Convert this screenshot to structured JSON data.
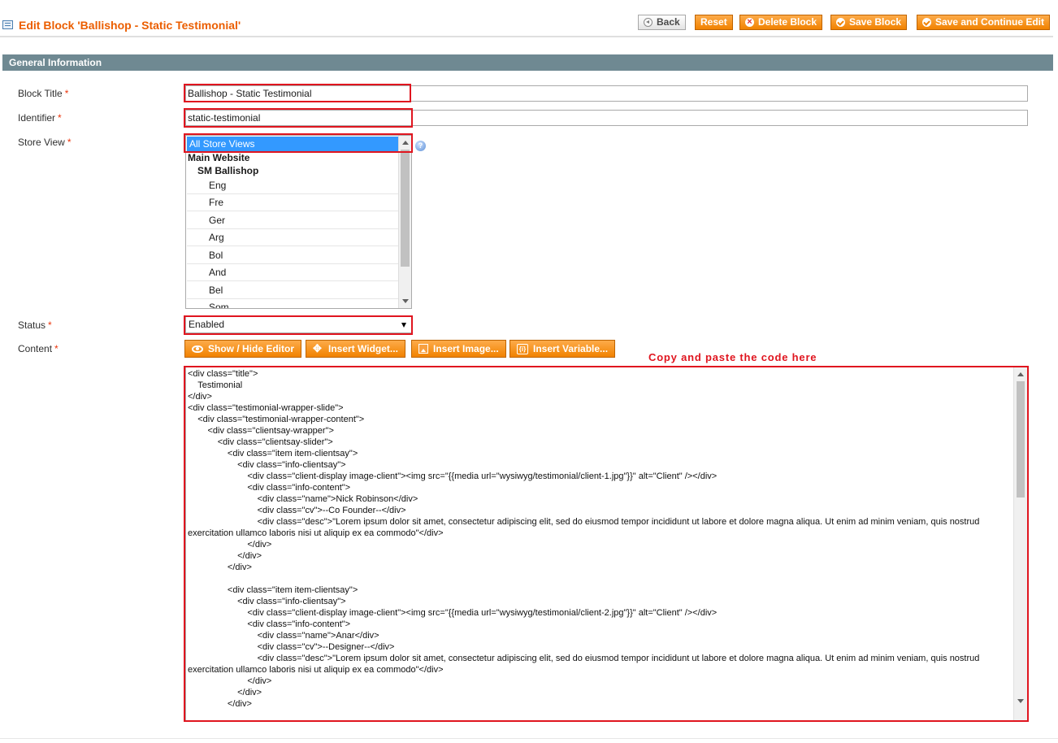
{
  "header": {
    "title": "Edit Block 'Ballishop - Static Testimonial'",
    "icon": "grid-icon",
    "buttons": {
      "back": "Back",
      "reset": "Reset",
      "delete": "Delete Block",
      "save": "Save Block",
      "save_continue": "Save and Continue Edit"
    }
  },
  "section": {
    "title": "General Information"
  },
  "form": {
    "block_title": {
      "label": "Block Title",
      "required": "*",
      "value": "Ballishop - Static Testimonial"
    },
    "identifier": {
      "label": "Identifier",
      "required": "*",
      "value": "static-testimonial"
    },
    "store_view": {
      "label": "Store View",
      "required": "*",
      "selected": "All Store Views",
      "group": "Main Website",
      "subgroup": "SM Ballishop",
      "options": [
        "Eng",
        "Fre",
        "Ger",
        "Arg",
        "Bol",
        "And",
        "Bel",
        "Som"
      ]
    },
    "status": {
      "label": "Status",
      "required": "*",
      "value": "Enabled"
    },
    "content": {
      "label": "Content",
      "required": "*"
    }
  },
  "editor_buttons": {
    "show_hide": "Show / Hide Editor",
    "insert_widget": "Insert Widget...",
    "insert_image": "Insert Image...",
    "insert_variable": "Insert Variable..."
  },
  "annotation": "Copy and paste the code here",
  "code": "<div class=\"title\">\n\tTestimonial\n</div>\n<div class=\"testimonial-wrapper-slide\">\n\t<div class=\"testimonial-wrapper-content\">\n\t\t<div class=\"clientsay-wrapper\">\n\t\t\t<div class=\"clientsay-slider\">\n\t\t\t\t<div class=\"item item-clientsay\">\n\t\t\t\t\t<div class=\"info-clientsay\">\n\t\t\t\t\t\t<div class=\"client-display image-client\"><img src=\"{{media url=\"wysiwyg/testimonial/client-1.jpg\"}}\" alt=\"Client\" /></div>\n\t\t\t\t\t\t<div class=\"info-content\">\n\t\t\t\t\t\t\t<div class=\"name\">Nick Robinson</div>\n\t\t\t\t\t\t\t<div class=\"cv\">--Co Founder--</div>\n\t\t\t\t\t\t\t<div class=\"desc\">\"Lorem ipsum dolor sit amet, consectetur adipiscing elit, sed do eiusmod tempor incididunt ut labore et dolore magna aliqua. Ut enim ad minim veniam, quis nostrud exercitation ullamco laboris nisi ut aliquip ex ea commodo\"</div>\n\t\t\t\t\t\t</div>\n\t\t\t\t\t</div>\n\t\t\t\t</div>\n\n\t\t\t\t<div class=\"item item-clientsay\">\n\t\t\t\t\t<div class=\"info-clientsay\">\n\t\t\t\t\t\t<div class=\"client-display image-client\"><img src=\"{{media url=\"wysiwyg/testimonial/client-2.jpg\"}}\" alt=\"Client\" /></div>\n\t\t\t\t\t\t<div class=\"info-content\">\n\t\t\t\t\t\t\t<div class=\"name\">Anar</div>\n\t\t\t\t\t\t\t<div class=\"cv\">--Designer--</div>\n\t\t\t\t\t\t\t<div class=\"desc\">\"Lorem ipsum dolor sit amet, consectetur adipiscing elit, sed do eiusmod tempor incididunt ut labore et dolore magna aliqua. Ut enim ad minim veniam, quis nostrud exercitation ullamco laboris nisi ut aliquip ex ea commodo\"</div>\n\t\t\t\t\t\t</div>\n\t\t\t\t\t</div>\n\t\t\t\t</div>",
  "colors": {
    "accent": "#eb5e00",
    "button": "#f18200",
    "section_bar": "#6f8992",
    "highlight_box": "#e0151f",
    "selection": "#3399ff"
  }
}
